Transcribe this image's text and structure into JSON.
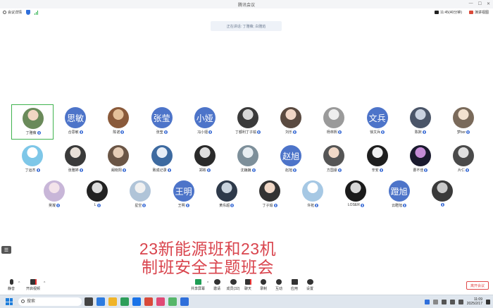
{
  "window": {
    "title": "腾讯会议",
    "controls": [
      "—",
      "☐",
      "✕"
    ]
  },
  "info": {
    "details_label": "会议详情",
    "duration": "11:45(40分钟)",
    "view_label": "演讲视图"
  },
  "speaking_text": "正在讲话: 丁雅薇; 白雅焰",
  "participants": [
    {
      "name": "丁雅薇",
      "type": "photo",
      "c1": "#f1d6c3",
      "c2": "#6a8a5a",
      "active": true
    },
    {
      "name": "合思敏",
      "type": "text",
      "avatar_text": "思敏"
    },
    {
      "name": "陈诺",
      "type": "photo",
      "c1": "#e4c09a",
      "c2": "#8a5a3a"
    },
    {
      "name": "张莹",
      "type": "text",
      "avatar_text": "张莹"
    },
    {
      "name": "冯小娅",
      "type": "text",
      "avatar_text": "小娅"
    },
    {
      "name": "丁都利丁子瑜",
      "type": "photo",
      "c1": "#d8d8d8",
      "c2": "#3a3a3a"
    },
    {
      "name": "刘乐",
      "type": "photo",
      "c1": "#f0d5c5",
      "c2": "#5a4a40"
    },
    {
      "name": "杨林熙",
      "type": "photo",
      "c1": "#eeeeee",
      "c2": "#9a9a9a"
    },
    {
      "name": "徐文兵",
      "type": "text",
      "avatar_text": "文兵"
    },
    {
      "name": "陈默",
      "type": "photo",
      "c1": "#c9d2e0",
      "c2": "#4a5568"
    },
    {
      "name": "梦bor",
      "type": "photo",
      "c1": "#f2e1cf",
      "c2": "#7a6a5a"
    },
    {
      "name": "丁运杰",
      "type": "photo",
      "c1": "#ffffff",
      "c2": "#7ec7e8"
    },
    {
      "name": "张雅婷",
      "type": "photo",
      "c1": "#e8e0d8",
      "c2": "#3a3a3a"
    },
    {
      "name": "阚晓阳",
      "type": "photo",
      "c1": "#e6cdb6",
      "c2": "#6a5545"
    },
    {
      "name": "致成记录",
      "type": "photo",
      "c1": "#e7eef7",
      "c2": "#3d6aa0"
    },
    {
      "name": "郑彬",
      "type": "photo",
      "c1": "#dedede",
      "c2": "#2a2a2a"
    },
    {
      "name": "沈巍巍",
      "type": "photo",
      "c1": "#e8eef2",
      "c2": "#7d8f9a"
    },
    {
      "name": "赵旭",
      "type": "text",
      "avatar_text": "赵旭"
    },
    {
      "name": "方国豪",
      "type": "photo",
      "c1": "#f1d9c8",
      "c2": "#555555"
    },
    {
      "name": "辛安",
      "type": "photo",
      "c1": "#efefef",
      "c2": "#1e1e1e"
    },
    {
      "name": "曹不佳",
      "type": "photo",
      "c1": "#c48bd6",
      "c2": "#1a1a2e"
    },
    {
      "name": "片仁",
      "type": "photo",
      "c1": "#e0e0e0",
      "c2": "#4a4a4a"
    },
    {
      "name": "吴凝",
      "type": "photo",
      "c1": "#f3e3ea",
      "c2": "#c8b6d8"
    },
    {
      "name": "L",
      "type": "photo",
      "c1": "#dcdcdc",
      "c2": "#222222"
    },
    {
      "name": "星空",
      "type": "photo",
      "c1": "#f1f1f1",
      "c2": "#b0c4d8"
    },
    {
      "name": "王明",
      "type": "text",
      "avatar_text": "王明"
    },
    {
      "name": "黄东超",
      "type": "photo",
      "c1": "#c9d3dd",
      "c2": "#2e3a4a"
    },
    {
      "name": "丁子瑜",
      "type": "photo",
      "c1": "#f0d7c6",
      "c2": "#333333"
    },
    {
      "name": "许拓",
      "type": "photo",
      "c1": "#ffffff",
      "c2": "#a6c8e4"
    },
    {
      "name": "LOSER",
      "type": "photo",
      "c1": "#d8d8d8",
      "c2": "#1b1b1b"
    },
    {
      "name": "云瞪旭",
      "type": "text",
      "avatar_text": "蹬旭"
    },
    {
      "name": "",
      "type": "photo",
      "c1": "#c9c9c9",
      "c2": "#3a3a3a"
    }
  ],
  "overlay_title": [
    "23新能源班和23机",
    "制班安全主题班会"
  ],
  "toolbar": {
    "mute": "静音",
    "video": "开启视频",
    "share": "共享屏幕",
    "invite": "邀请",
    "members": "成员(32)",
    "chat": "聊天",
    "record": "录制",
    "interact": "互动",
    "apps": "应用",
    "settings": "设置",
    "end": "离开会议"
  },
  "taskbar": {
    "search_placeholder": "搜索",
    "time": "11:09",
    "date": "2025/2/17"
  }
}
